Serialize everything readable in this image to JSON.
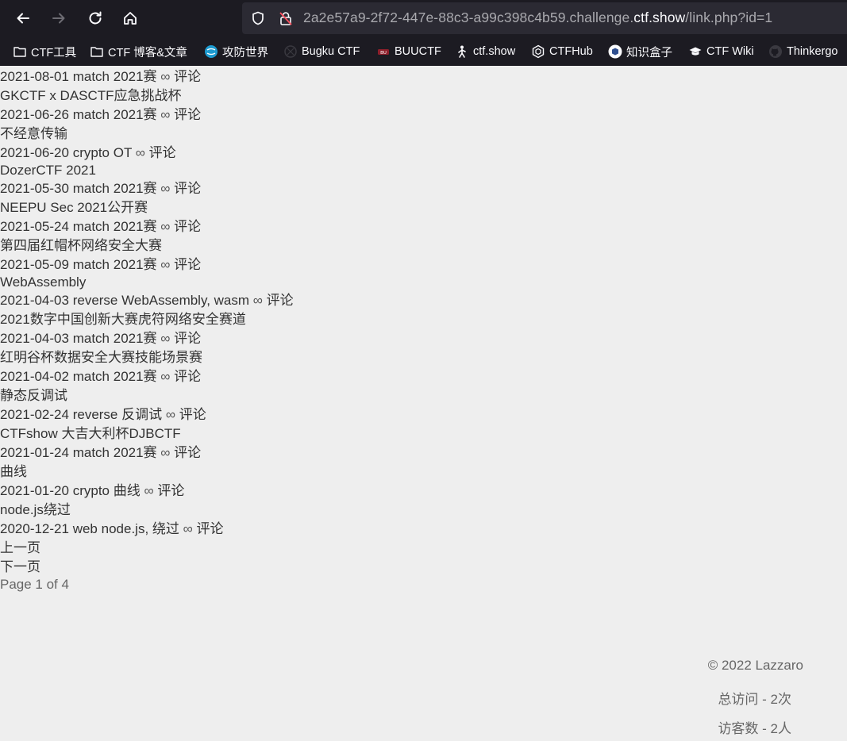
{
  "browser": {
    "url_prefix": "2a2e57a9-2f72-447e-88c3-a99c398c4b59.challenge.",
    "url_host": "ctf.show",
    "url_suffix": "/link.php?id=1",
    "bookmarks": [
      {
        "label": "CTF工具",
        "icon": "folder-icon"
      },
      {
        "label": "CTF 博客&文章",
        "icon": "folder-icon"
      },
      {
        "label": "攻防世界",
        "icon": "globe-icon"
      },
      {
        "label": "Bugku CTF",
        "icon": "bugku-icon"
      },
      {
        "label": "BUUCTF",
        "icon": "buuctf-icon"
      },
      {
        "label": "ctf.show",
        "icon": "ctfshow-icon"
      },
      {
        "label": "CTFHub",
        "icon": "ctfhub-icon"
      },
      {
        "label": "知识盒子",
        "icon": "box-icon"
      },
      {
        "label": "CTF Wiki",
        "icon": "wiki-icon"
      },
      {
        "label": "Thinkergo",
        "icon": "github-icon"
      }
    ]
  },
  "posts": [
    {
      "title": null,
      "meta": {
        "date": "2021-08-01",
        "category": "match",
        "tags": "2021赛",
        "infinity": "∞",
        "comment": "评论"
      }
    },
    {
      "title": "GKCTF x DASCTF应急挑战杯",
      "meta": {
        "date": "2021-06-26",
        "category": "match",
        "tags": "2021赛",
        "infinity": "∞",
        "comment": "评论"
      }
    },
    {
      "title": "不经意传输",
      "meta": {
        "date": "2021-06-20",
        "category": "crypto",
        "tags": "OT",
        "infinity": "∞",
        "comment": "评论"
      }
    },
    {
      "title": "DozerCTF 2021",
      "meta": {
        "date": "2021-05-30",
        "category": "match",
        "tags": "2021赛",
        "infinity": "∞",
        "comment": "评论"
      }
    },
    {
      "title": "NEEPU Sec 2021公开赛",
      "meta": {
        "date": "2021-05-24",
        "category": "match",
        "tags": "2021赛",
        "infinity": "∞",
        "comment": "评论"
      }
    },
    {
      "title": "第四届红帽杯网络安全大赛",
      "meta": {
        "date": "2021-05-09",
        "category": "match",
        "tags": "2021赛",
        "infinity": "∞",
        "comment": "评论"
      }
    },
    {
      "title": "WebAssembly",
      "meta": {
        "date": "2021-04-03",
        "category": "reverse",
        "tags": "WebAssembly, wasm",
        "infinity": "∞",
        "comment": "评论"
      }
    },
    {
      "title": "2021数字中国创新大赛虎符网络安全赛道",
      "meta": {
        "date": "2021-04-03",
        "category": "match",
        "tags": "2021赛",
        "infinity": "∞",
        "comment": "评论"
      }
    },
    {
      "title": "红明谷杯数据安全大赛技能场景赛",
      "meta": {
        "date": "2021-04-02",
        "category": "match",
        "tags": "2021赛",
        "infinity": "∞",
        "comment": "评论"
      }
    },
    {
      "title": "静态反调试",
      "meta": {
        "date": "2021-02-24",
        "category": "reverse",
        "tags": "反调试",
        "infinity": "∞",
        "comment": "评论"
      }
    },
    {
      "title": "CTFshow 大吉大利杯DJBCTF",
      "meta": {
        "date": "2021-01-24",
        "category": "match",
        "tags": "2021赛",
        "infinity": "∞",
        "comment": "评论"
      }
    },
    {
      "title": "曲线",
      "meta": {
        "date": "2021-01-20",
        "category": "crypto",
        "tags": "曲线",
        "infinity": "∞",
        "comment": "评论"
      }
    },
    {
      "title": "node.js绕过",
      "meta": {
        "date": "2020-12-21",
        "category": "web",
        "tags": "node.js, 绕过",
        "infinity": "∞",
        "comment": "评论"
      }
    }
  ],
  "pagination": {
    "prev": "上一页",
    "next": "下一页",
    "page_info": "Page 1 of 4"
  },
  "footer": {
    "copyright": "© 2022 Lazzaro",
    "total_visits": "总访问 - 2次",
    "visitors": "访客数 - 2人"
  }
}
